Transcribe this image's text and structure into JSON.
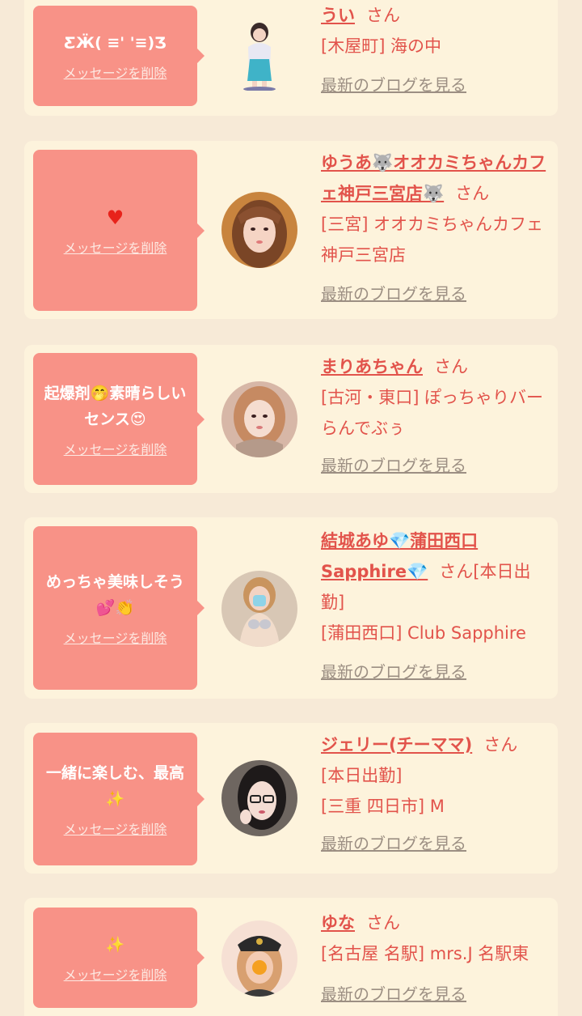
{
  "common": {
    "delete_label": "メッセージを削除",
    "blog_label": "最新のブログを見る",
    "suffix": "さん"
  },
  "cards": [
    {
      "message": "ƸӜ( ≡' '≡)Ʒ",
      "name": "うい",
      "location": "[木屋町] 海の中",
      "avatar_icon": "girl-standing-photo"
    },
    {
      "message": "♥",
      "name": "ゆうあ🐺オオカミちゃんカフェ神戸三宮店🐺",
      "location": "[三宮] オオカミちゃんカフェ神戸三宮店",
      "avatar_icon": "girl-portrait-photo"
    },
    {
      "message": "起爆剤🤭素晴らしいセンス😍",
      "name": "まりあちゃん",
      "location": "[古河・東口] ぽっちゃりバー らんでぶぅ",
      "avatar_icon": "girl-portrait-photo"
    },
    {
      "message": "めっちゃ美味しそう💕👏",
      "name": "結城あゆ💎蒲田西口Sapphire💎",
      "status": "[本日出勤]",
      "location": "[蒲田西口] Club Sapphire",
      "avatar_icon": "girl-portrait-photo"
    },
    {
      "message": "一緒に楽しむ、最高✨",
      "name": "ジェリー(チーママ)",
      "status": "[本日出勤]",
      "location": "[三重 四日市] M",
      "avatar_icon": "girl-glasses-photo"
    },
    {
      "message": "✨",
      "name": "ゆな",
      "location": "[名古屋 名駅] mrs.J 名駅東",
      "avatar_icon": "girl-police-hat-photo"
    }
  ],
  "colors": {
    "page_bg": "#f7ead7",
    "card_bg": "#fdf3dc",
    "bubble_bg": "#f89287",
    "name_color": "#e2534b",
    "blog_link_color": "#9c8f83"
  }
}
